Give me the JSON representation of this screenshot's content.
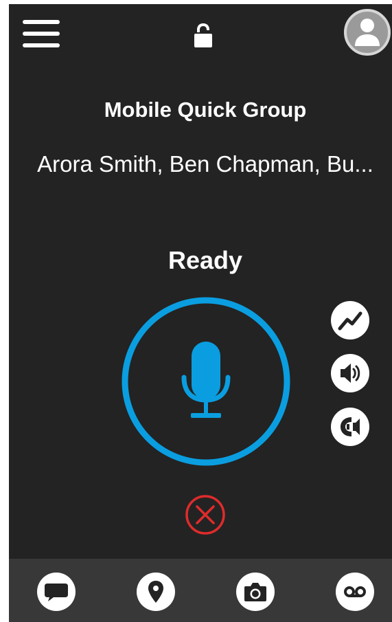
{
  "header": {
    "menu_icon": "hamburger-menu-icon",
    "lock_icon": "unlocked-padlock-icon",
    "avatar_icon": "user-avatar-icon"
  },
  "call": {
    "group_name": "Mobile Quick Group",
    "members": "Arora Smith, Ben Chapman, Bu...",
    "status": "Ready"
  },
  "controls": {
    "ptt_icon": "microphone-icon",
    "side_buttons": [
      "signal-chart-icon",
      "speaker-volume-icon",
      "ear-speaker-icon"
    ],
    "cancel_icon": "cancel-x-icon"
  },
  "bottom_nav": [
    "chat-bubble-icon",
    "location-pin-icon",
    "camera-icon",
    "voicemail-icon"
  ],
  "colors": {
    "background": "#232323",
    "accent": "#0a9ee0",
    "cancel": "#e02b2b",
    "bottom_bar": "#383838"
  }
}
